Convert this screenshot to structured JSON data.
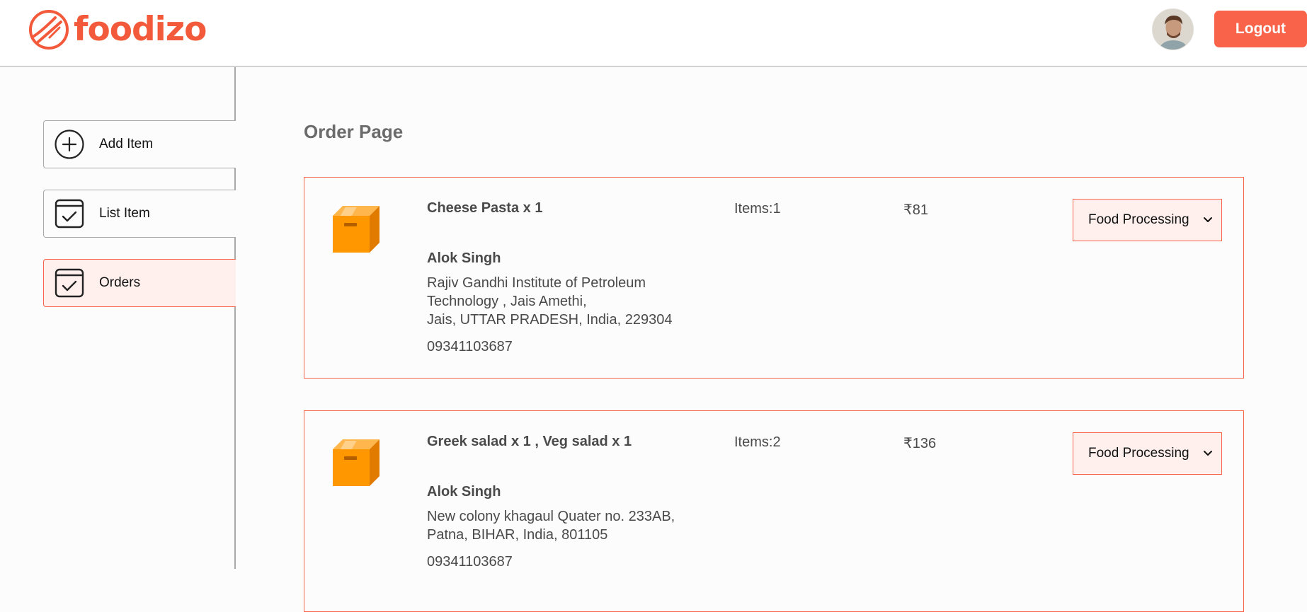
{
  "navbar": {
    "brand": "foodizo",
    "logout_label": "Logout",
    "accent_color": "#f8634a"
  },
  "sidebar": {
    "items": [
      {
        "label": "Add Item",
        "icon": "add-circle-icon",
        "active": false
      },
      {
        "label": "List Item",
        "icon": "calendar-check-icon",
        "active": false
      },
      {
        "label": "Orders",
        "icon": "calendar-check-icon",
        "active": true
      }
    ]
  },
  "main": {
    "title": "Order Page",
    "orders": [
      {
        "food": "Cheese Pasta x 1",
        "items": "Items:1",
        "amount": "₹81",
        "name": "Alok Singh",
        "address_lines": [
          "Rajiv Gandhi Institute of Petroleum",
          "Technology , Jais Amethi,",
          "Jais, UTTAR PRADESH, India, 229304"
        ],
        "phone": "09341103687",
        "status": "Food Processing"
      },
      {
        "food": "Greek salad x 1 , Veg salad x 1",
        "items": "Items:2",
        "amount": "₹136",
        "name": "Alok Singh",
        "address_lines": [
          "New colony khagaul Quater no. 233AB,",
          "Patna, BIHAR, India, 801105"
        ],
        "phone": "09341103687",
        "status": "Food Processing"
      }
    ]
  }
}
